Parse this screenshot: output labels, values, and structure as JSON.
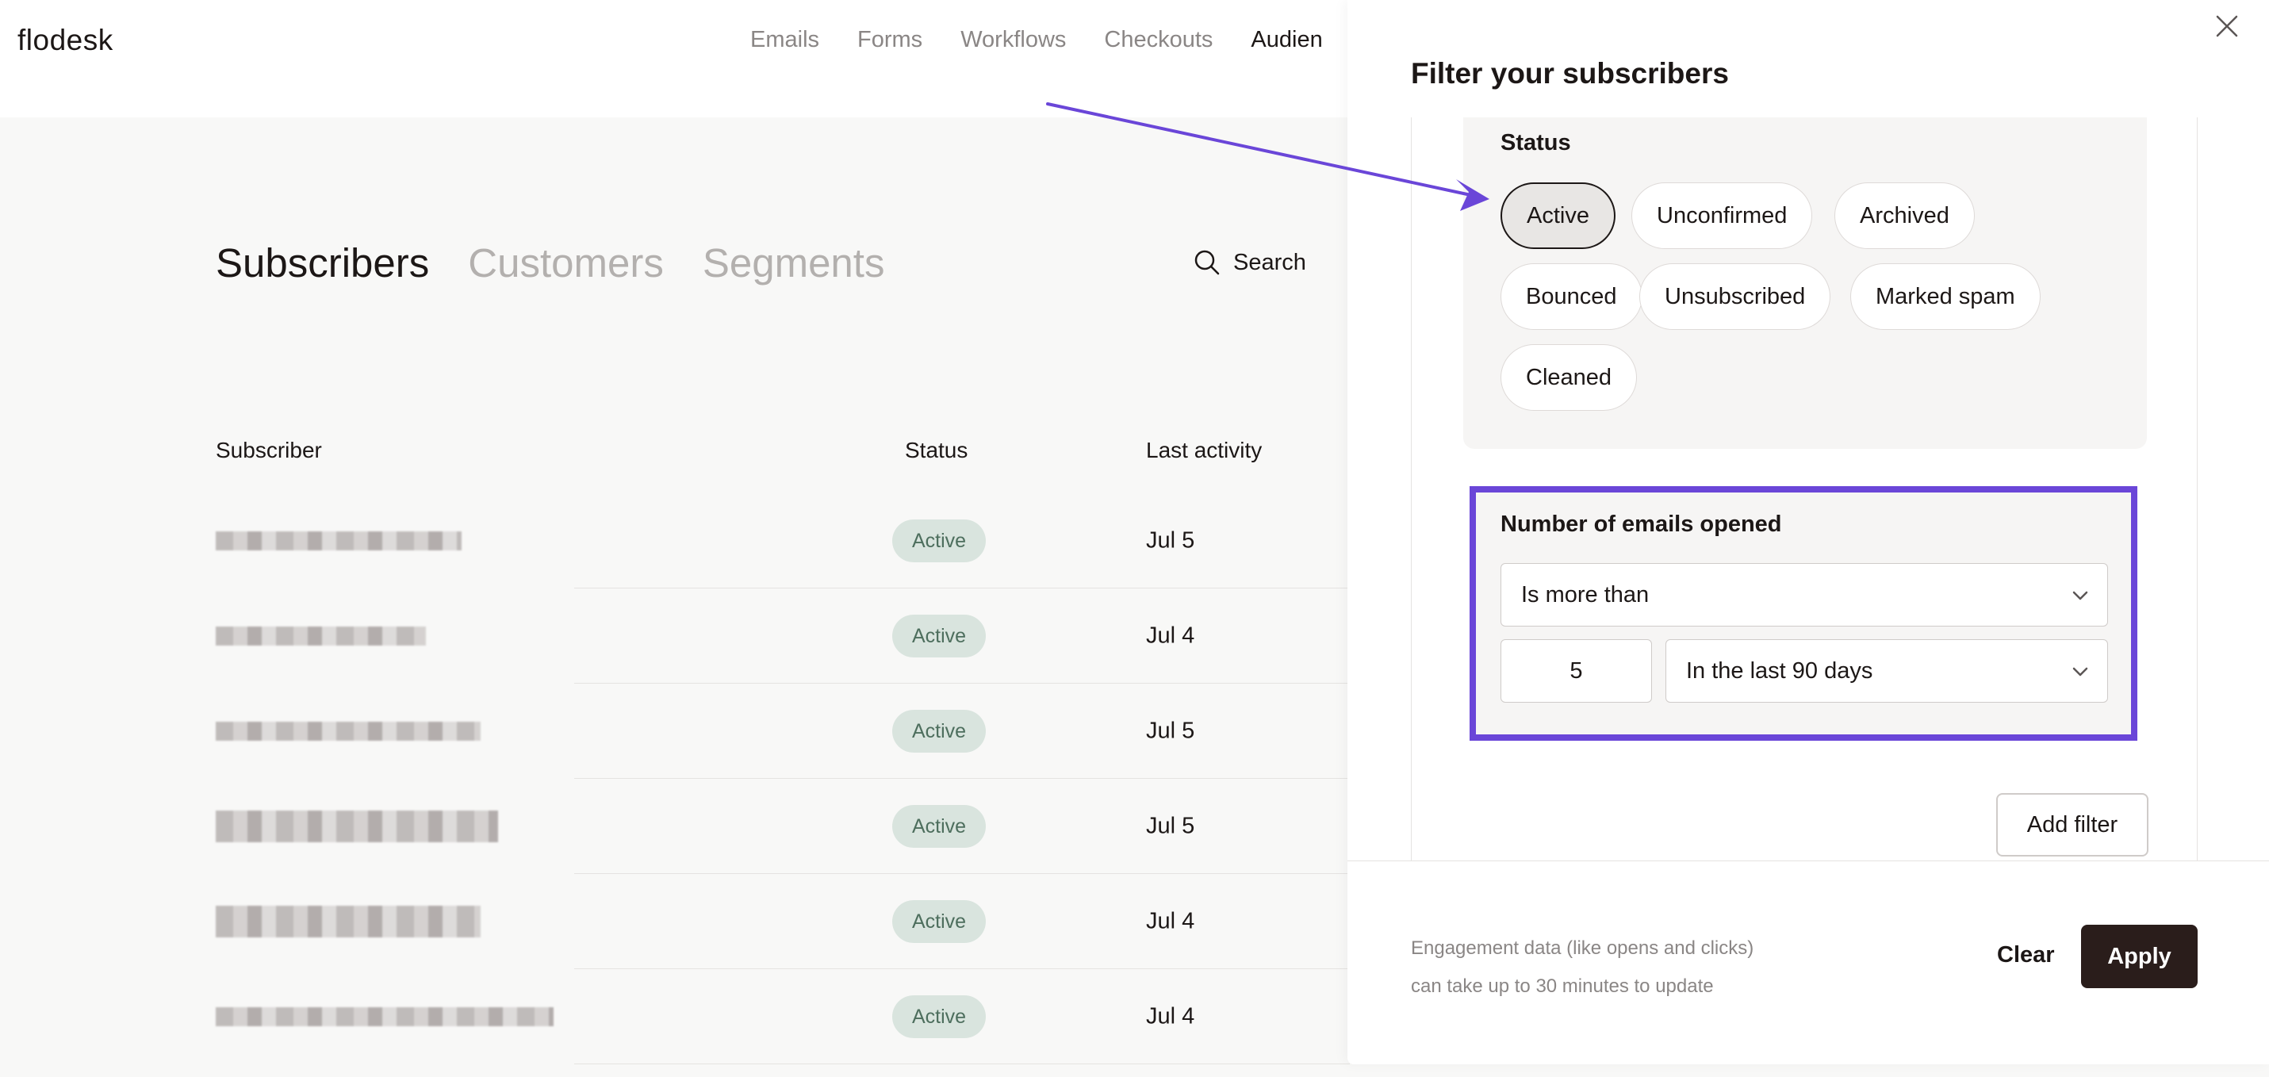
{
  "app": {
    "logo": "flodesk",
    "nav": [
      "Emails",
      "Forms",
      "Workflows",
      "Checkouts",
      "Audien"
    ]
  },
  "page": {
    "tabs": [
      "Subscribers",
      "Customers",
      "Segments"
    ],
    "search_label": "Search",
    "columns": {
      "subscriber": "Subscriber",
      "status": "Status",
      "last_activity": "Last activity"
    },
    "rows": [
      {
        "status": "Active",
        "last_activity": "Jul 5"
      },
      {
        "status": "Active",
        "last_activity": "Jul 4"
      },
      {
        "status": "Active",
        "last_activity": "Jul 5"
      },
      {
        "status": "Active",
        "last_activity": "Jul 5"
      },
      {
        "status": "Active",
        "last_activity": "Jul 4"
      },
      {
        "status": "Active",
        "last_activity": "Jul 4"
      }
    ]
  },
  "drawer": {
    "title": "Filter your subscribers",
    "status_label": "Status",
    "status_options": [
      {
        "label": "Active",
        "selected": true
      },
      {
        "label": "Unconfirmed",
        "selected": false
      },
      {
        "label": "Archived",
        "selected": false
      },
      {
        "label": "Bounced",
        "selected": false
      },
      {
        "label": "Unsubscribed",
        "selected": false
      },
      {
        "label": "Marked spam",
        "selected": false
      },
      {
        "label": "Cleaned",
        "selected": false
      }
    ],
    "emails_opened": {
      "label": "Number of emails opened",
      "comparison": "Is more than",
      "count": "5",
      "period": "In the last 90 days"
    },
    "add_filter": "Add filter",
    "note_line1": "Engagement data (like opens and clicks)",
    "note_line2": "can take up to 30 minutes to update",
    "clear": "Clear",
    "apply": "Apply"
  },
  "colors": {
    "highlight": "#6a46d8",
    "apply_bg": "#2a1d1b",
    "badge_bg": "#d9e4de",
    "badge_text": "#4d6e5d"
  }
}
